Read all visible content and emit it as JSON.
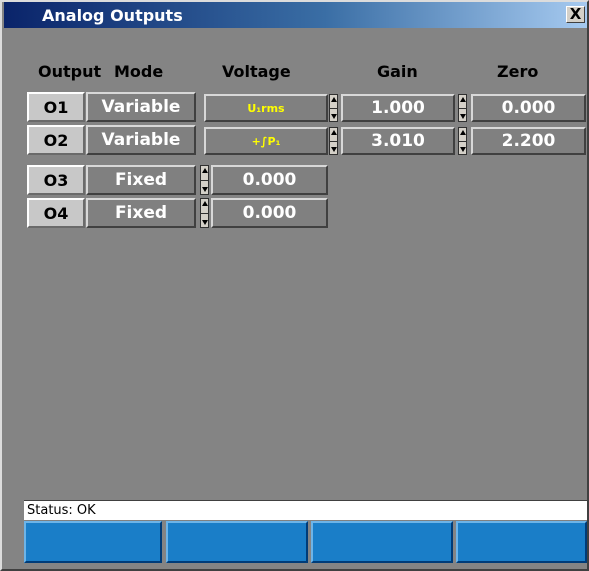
{
  "window": {
    "title": "Analog Outputs",
    "close_glyph": "X"
  },
  "headers": {
    "output": "Output",
    "mode": "Mode",
    "voltage": "Voltage",
    "gain": "Gain",
    "zero": "Zero"
  },
  "rows": [
    {
      "output": "O1",
      "mode": "Variable",
      "voltage": "U₁rms",
      "gain": "1.000",
      "zero": "0.000"
    },
    {
      "output": "O2",
      "mode": "Variable",
      "voltage": "+∫P₁",
      "gain": "3.010",
      "zero": "2.200"
    },
    {
      "output": "O3",
      "mode": "Fixed",
      "voltage": "0.000"
    },
    {
      "output": "O4",
      "mode": "Fixed",
      "voltage": "0.000"
    }
  ],
  "status": {
    "text": "Status: OK"
  },
  "colors": {
    "panel": "#848484",
    "title_bar": "#0a246a",
    "variable_text": "#ffff00",
    "buttons": "#1a7ec8"
  }
}
